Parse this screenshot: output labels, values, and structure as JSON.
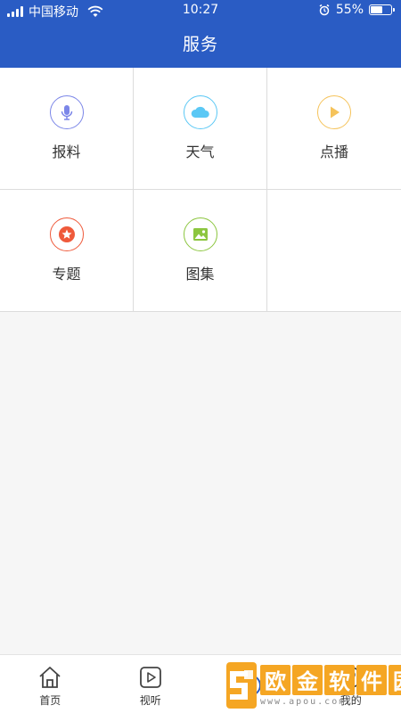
{
  "status_bar": {
    "carrier": "中国移动",
    "time": "10:27",
    "battery_percent": "55%",
    "battery_level": 0.55
  },
  "header": {
    "title": "服务"
  },
  "services": [
    {
      "label": "报料",
      "icon": "microphone-icon",
      "color": "#7b86e8"
    },
    {
      "label": "天气",
      "icon": "cloud-icon",
      "color": "#5bc8f5"
    },
    {
      "label": "点播",
      "icon": "play-icon",
      "color": "#f5c35b"
    },
    {
      "label": "专题",
      "icon": "star-icon",
      "color": "#ef5a3b"
    },
    {
      "label": "图集",
      "icon": "image-icon",
      "color": "#8cc63f"
    }
  ],
  "tabbar": {
    "items": [
      {
        "label": "首页",
        "icon": "home-icon"
      },
      {
        "label": "视听",
        "icon": "video-play-icon"
      },
      {
        "label": "",
        "icon": "service-icon"
      },
      {
        "label": "我的",
        "icon": "profile-icon"
      }
    ]
  },
  "watermark": {
    "chars": [
      "欧",
      "金",
      "软",
      "件",
      "园"
    ],
    "url": "www.apou.com"
  }
}
